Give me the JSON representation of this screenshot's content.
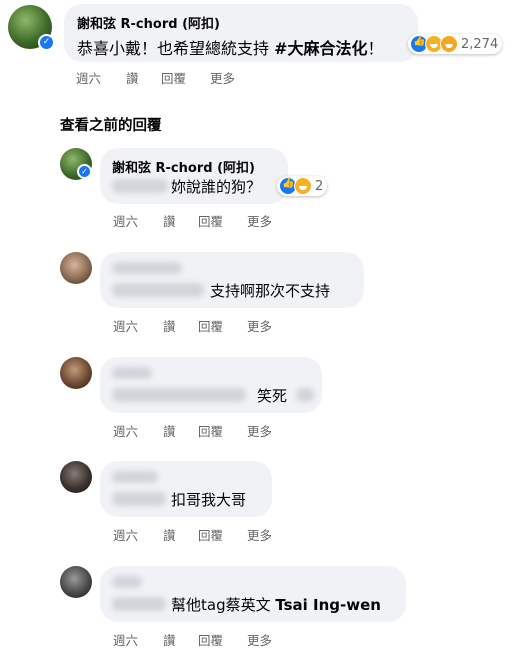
{
  "main_comment": {
    "author": "謝和弦 R-chord (阿扣)",
    "text": "恭喜小戴！也希望總統支持 ",
    "hashtag": "#大麻合法化",
    "text_end": "！",
    "reaction_count": "2,274",
    "actions": [
      "週六",
      "讚",
      "回覆",
      "更多"
    ]
  },
  "view_previous": "查看之前的回覆",
  "replies": [
    {
      "author": "謝和弦 R-chord (阿扣)",
      "text": "妳說誰的狗？",
      "reaction_count": "2",
      "actions": [
        "週六",
        "讚",
        "回覆",
        "更多"
      ]
    },
    {
      "text": "支持啊那次不支持",
      "actions": [
        "週六",
        "讚",
        "回覆",
        "更多"
      ]
    },
    {
      "text": "笑死",
      "actions": [
        "週六",
        "讚",
        "回覆",
        "更多"
      ]
    },
    {
      "text": "扣哥我大哥",
      "actions": [
        "週六",
        "讚",
        "回覆",
        "更多"
      ]
    },
    {
      "text": "幫他tag蔡英文 ",
      "tag": "Tsai Ing-wen",
      "actions": [
        "週六",
        "讚",
        "回覆",
        "更多"
      ]
    }
  ],
  "colors": {
    "bubble": "#f0f2f5",
    "secondary_text": "#65676b",
    "like_blue": "#1877f2",
    "haha_yellow": "#f7b125"
  }
}
